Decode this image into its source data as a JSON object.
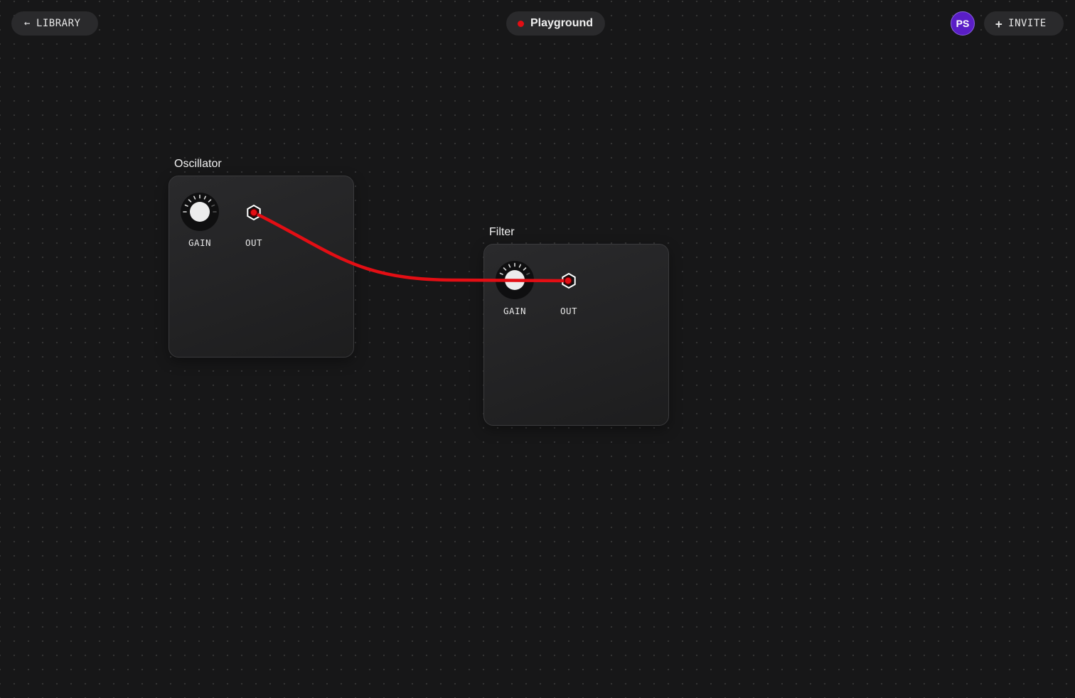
{
  "toolbar": {
    "library_label": "LIBRARY",
    "invite_label": "INVITE"
  },
  "project": {
    "title": "Playground",
    "status_color": "#e30e14"
  },
  "user": {
    "initials": "PS",
    "avatar_color": "#5a1ec6"
  },
  "nodes": [
    {
      "title": "Oscillator",
      "controls": [
        {
          "label": "GAIN",
          "type": "knob"
        },
        {
          "label": "OUT",
          "type": "port"
        }
      ]
    },
    {
      "title": "Filter",
      "controls": [
        {
          "label": "GAIN",
          "type": "knob"
        },
        {
          "label": "OUT",
          "type": "port"
        }
      ]
    }
  ],
  "cables": [
    {
      "from": "Oscillator.OUT",
      "to": "Filter.OUT",
      "color": "#e30e14"
    }
  ],
  "icons": {
    "back": "arrow-left-icon",
    "add": "plus-icon",
    "status": "status-dot-icon"
  }
}
